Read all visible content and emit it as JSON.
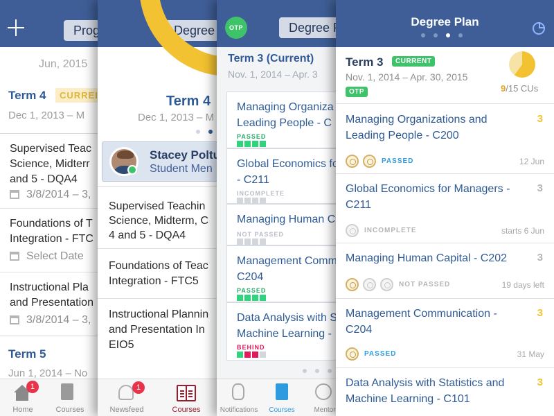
{
  "panel1": {
    "add_icon_label": "+",
    "nav_button": "Prog",
    "date_header": "Jun, 2015",
    "term4": {
      "title": "Term 4",
      "badge": "CURREI",
      "dates": "Dec 1, 2013 – M"
    },
    "items": [
      {
        "lines": [
          "Supervised Teac",
          "Science, Midterr",
          "and 5 - DQA4"
        ],
        "date": "3/8/2014 – 3,"
      },
      {
        "lines": [
          "Foundations of T",
          "Integration - FTC"
        ],
        "date": "Select Date"
      },
      {
        "lines": [
          "Instructional Pla",
          "and Presentation"
        ],
        "date": "3/8/2014 – 3,"
      }
    ],
    "term5": {
      "title": "Term 5",
      "dates": "Jun 1, 2014 – No"
    },
    "tabs": [
      {
        "label": "Home",
        "badge": "1"
      },
      {
        "label": "Courses"
      }
    ]
  },
  "panel2": {
    "nav_button": "Degree",
    "term4": {
      "title": "Term 4",
      "dates": "Dec 1, 2013 – M"
    },
    "mentor": {
      "name": "Stacey Poltu",
      "role": "Student Men"
    },
    "items": [
      {
        "lines": [
          "Supervised Teachin",
          "Science, Midterm, C",
          "4 and 5 - DQA4"
        ]
      },
      {
        "lines": [
          "Foundations of Teac",
          "Integration - FTC5"
        ]
      },
      {
        "lines": [
          "Instructional Plannin",
          "and Presentation In",
          "EIO5"
        ]
      }
    ],
    "tabs": [
      {
        "label": "Newsfeed",
        "badge": "1"
      },
      {
        "label": "Courses"
      }
    ]
  },
  "panel3": {
    "otp_label": "OTP",
    "nav_button": "Degree P",
    "term_title": "Term 3 (Current)",
    "dates": "Nov. 1, 2014 – Apr. 3",
    "cards": [
      {
        "lines": [
          "Managing Organiza",
          "Leading People - C"
        ],
        "status": "PASSED"
      },
      {
        "lines": [
          "Global Economics fo",
          "- C211"
        ],
        "status": "INCOMPLETE"
      },
      {
        "lines": [
          "Managing Human C"
        ],
        "status": "NOT PASSED"
      },
      {
        "lines": [
          "Management Comm",
          "C204"
        ],
        "status": "PASSED"
      },
      {
        "lines": [
          "Data Analysis with S",
          "Machine Learning -"
        ],
        "status": "BEHIND"
      }
    ],
    "tabs": [
      {
        "label": "Notifications"
      },
      {
        "label": "Courses"
      },
      {
        "label": "Mentor"
      }
    ]
  },
  "panel4": {
    "title": "Degree Plan",
    "term": {
      "title": "Term 3",
      "badge": "CURRENT",
      "dates": "Nov. 1, 2014 – Apr. 30, 2015",
      "otp": "OTP"
    },
    "cus": {
      "value": "9",
      "total": "/15 CUs"
    },
    "courses": [
      {
        "title_lines": [
          "Managing Organizations and",
          "Leading People - C200"
        ],
        "cu": "3",
        "status": "PASSED",
        "date": "12 Jun"
      },
      {
        "title_lines": [
          "Global Economics for Managers -",
          "C211"
        ],
        "cu": "3",
        "status": "INCOMPLETE",
        "date": "starts 6 Jun"
      },
      {
        "title_lines": [
          "Managing Human Capital - C202"
        ],
        "cu": "3",
        "status": "NOT PASSED",
        "date": "19 days left"
      },
      {
        "title_lines": [
          "Management Communication -",
          "C204"
        ],
        "cu": "3",
        "status": "PASSED",
        "date": "31 May"
      },
      {
        "title_lines": [
          "Data Analysis with Statistics and",
          "Machine Learning - C101"
        ],
        "cu": "3"
      }
    ]
  },
  "colors": {
    "navbar": "#3f5e97",
    "passed": "#2fd47d",
    "incomplete": "#d3d6da",
    "behind": "#e3195b",
    "current_green": "#3ec36a",
    "gold": "#f3c232",
    "accent_blue": "#2e9be0"
  }
}
